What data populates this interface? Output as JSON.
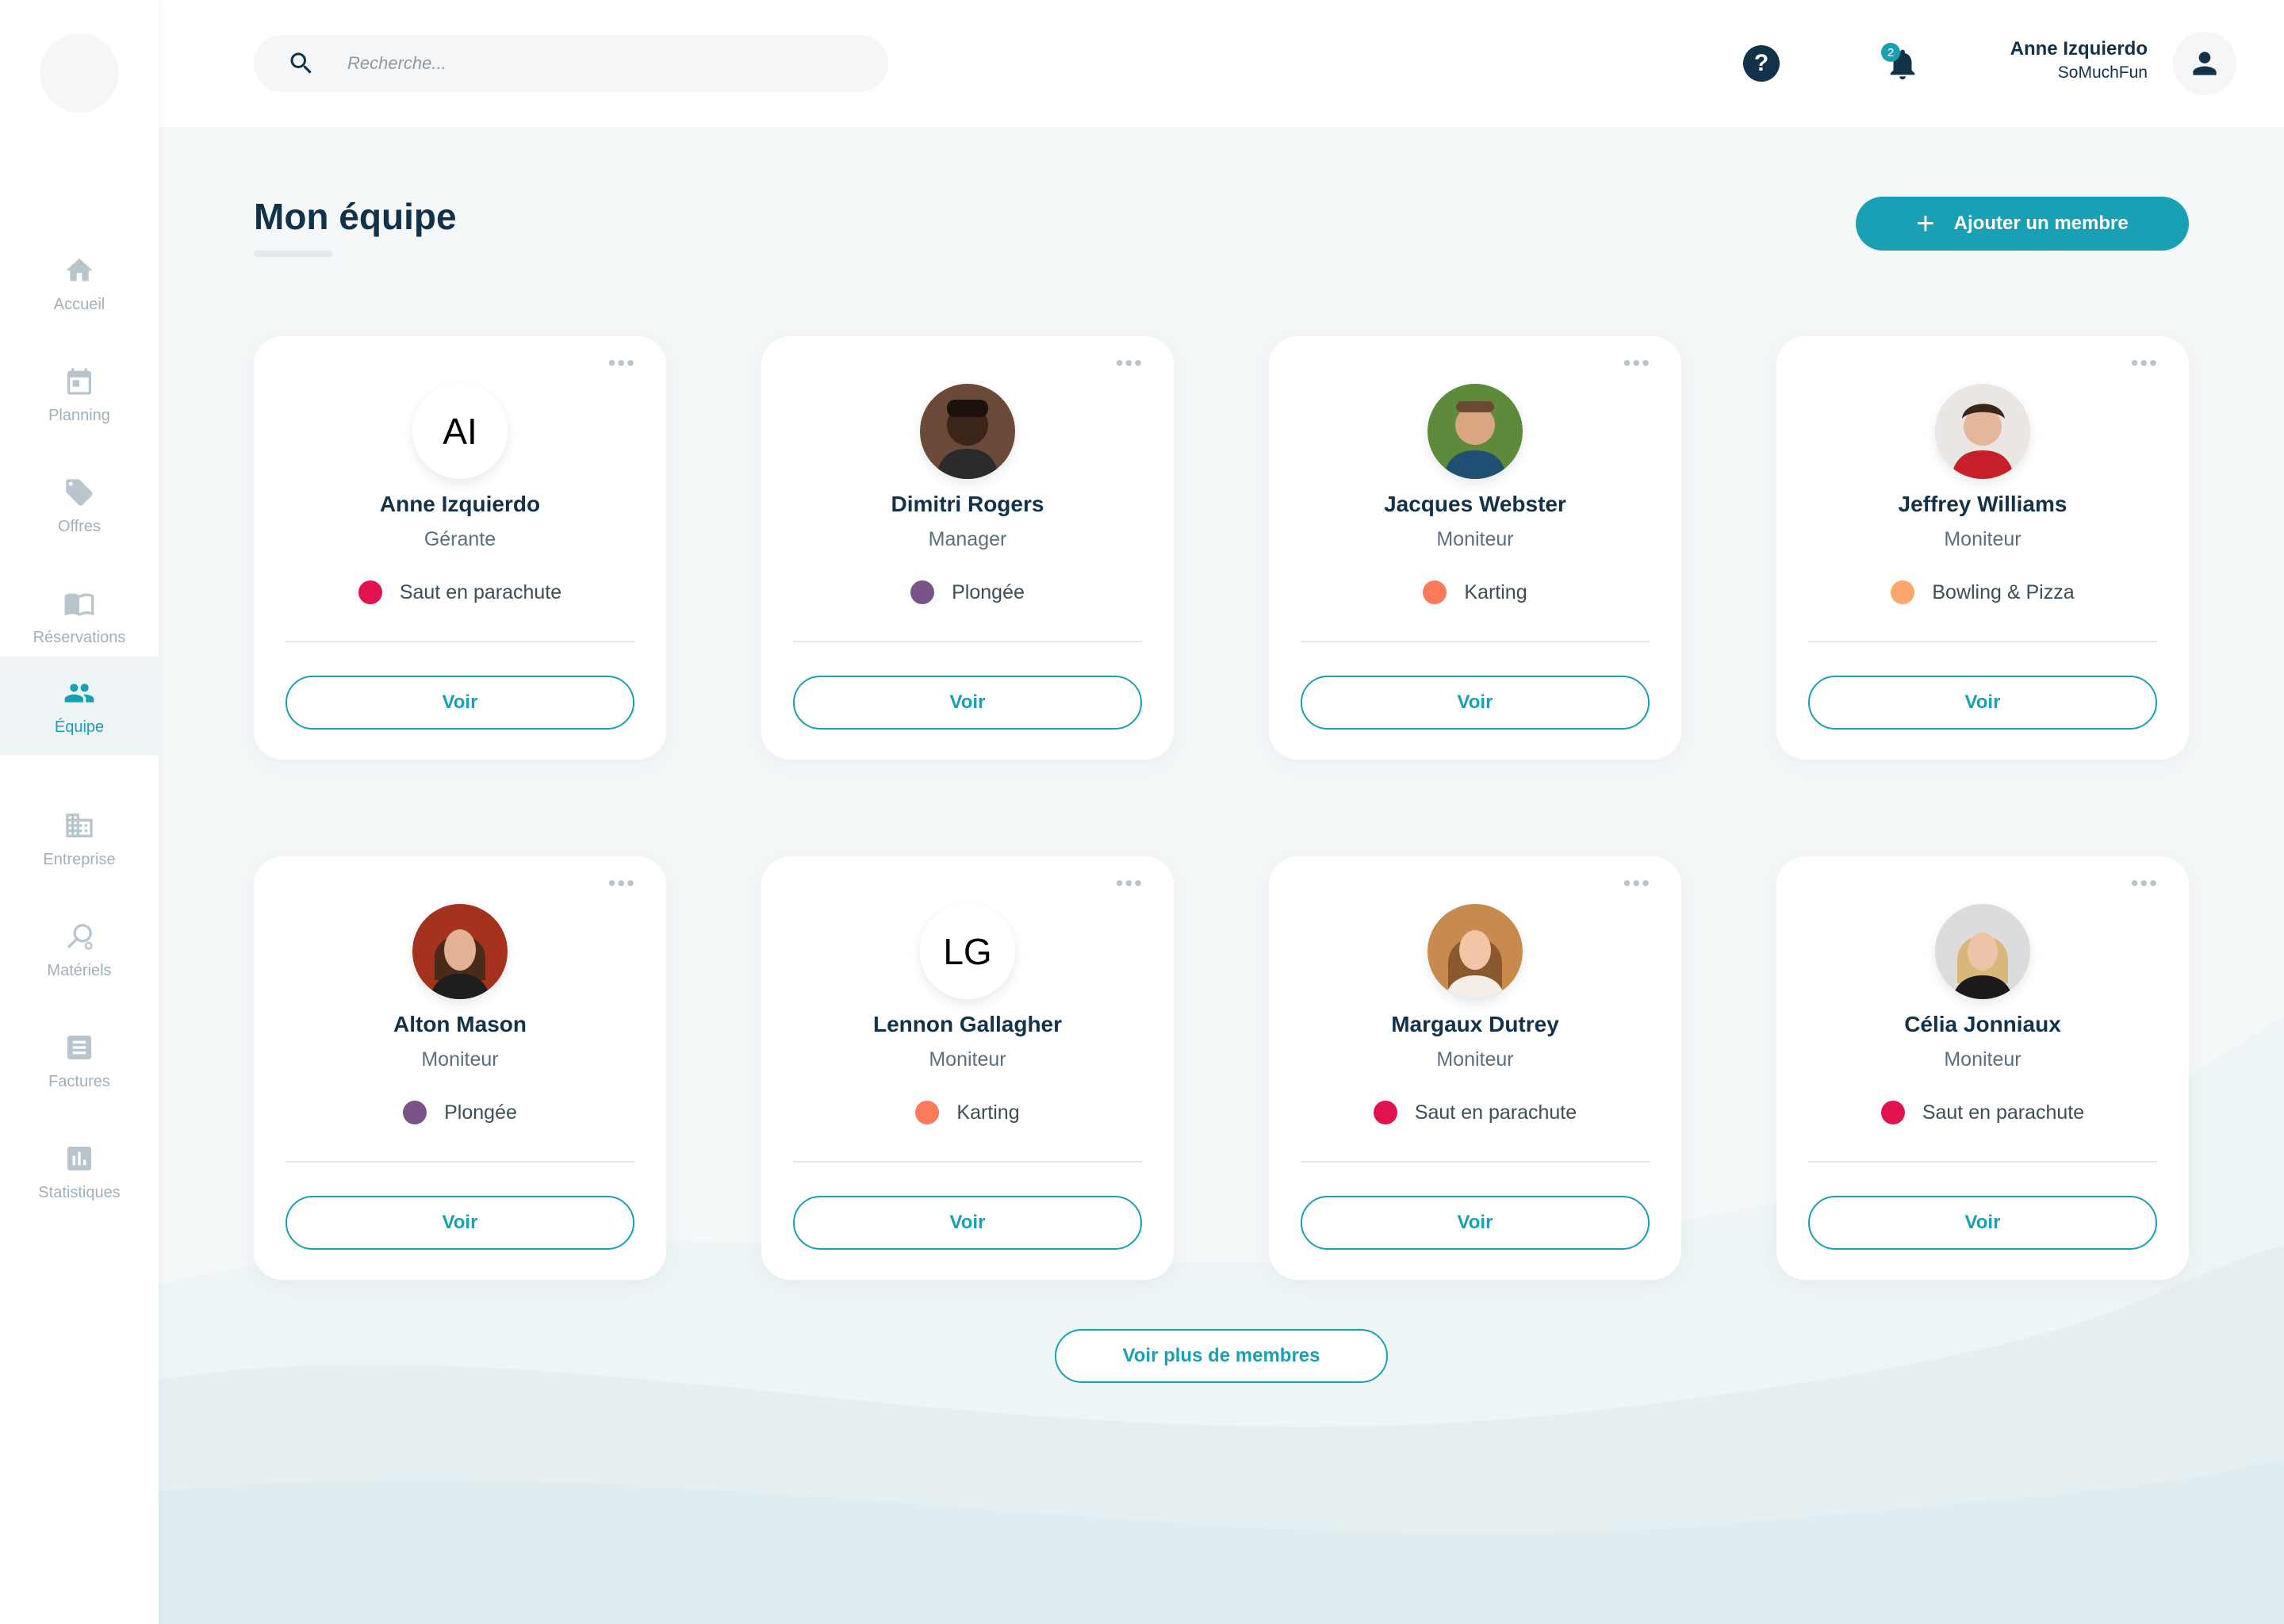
{
  "search": {
    "placeholder": "Recherche..."
  },
  "header": {
    "notifications_count": "2",
    "help_label": "?",
    "user_name": "Anne Izquierdo",
    "user_company": "SoMuchFun"
  },
  "sidebar": {
    "items": [
      {
        "label": "Accueil",
        "icon": "home-icon"
      },
      {
        "label": "Planning",
        "icon": "calendar-icon"
      },
      {
        "label": "Offres",
        "icon": "tag-icon"
      },
      {
        "label": "Réservations",
        "icon": "book-icon"
      },
      {
        "label": "Équipe",
        "icon": "team-icon",
        "active": true
      },
      {
        "label": "Entreprise",
        "icon": "building-icon"
      },
      {
        "label": "Matériels",
        "icon": "racket-icon"
      },
      {
        "label": "Factures",
        "icon": "invoice-icon"
      },
      {
        "label": "Statistiques",
        "icon": "chart-icon"
      }
    ]
  },
  "main": {
    "title": "Mon équipe",
    "add_button_label": "Ajouter un membre",
    "more_members_label": "Voir plus de membres",
    "members": [
      {
        "name": "Anne Izquierdo",
        "role": "Gérante",
        "activity": "Saut en parachute",
        "activity_color": "#e0134f",
        "initials": "AI",
        "photo": false,
        "view_label": "Voir",
        "more_label": "•••"
      },
      {
        "name": "Dimitri Rogers",
        "role": "Manager",
        "activity": "Plongée",
        "activity_color": "#7a5388",
        "initials": "",
        "photo": true,
        "view_label": "Voir",
        "more_label": "•••"
      },
      {
        "name": "Jacques Webster",
        "role": "Moniteur",
        "activity": "Karting",
        "activity_color": "#f97b5a",
        "initials": "",
        "photo": true,
        "view_label": "Voir",
        "more_label": "•••"
      },
      {
        "name": "Jeffrey Williams",
        "role": "Moniteur",
        "activity": "Bowling & Pizza",
        "activity_color": "#fba76d",
        "initials": "",
        "photo": true,
        "view_label": "Voir",
        "more_label": "•••"
      },
      {
        "name": "Alton Mason",
        "role": "Moniteur",
        "activity": "Plongée",
        "activity_color": "#7a5388",
        "initials": "",
        "photo": true,
        "view_label": "Voir",
        "more_label": "•••"
      },
      {
        "name": "Lennon Gallagher",
        "role": "Moniteur",
        "activity": "Karting",
        "activity_color": "#f97b5a",
        "initials": "LG",
        "photo": false,
        "view_label": "Voir",
        "more_label": "•••"
      },
      {
        "name": "Margaux Dutrey",
        "role": "Moniteur",
        "activity": "Saut en parachute",
        "activity_color": "#e0134f",
        "initials": "",
        "photo": true,
        "view_label": "Voir",
        "more_label": "•••"
      },
      {
        "name": "Célia Jonniaux",
        "role": "Moniteur",
        "activity": "Saut en parachute",
        "activity_color": "#e0134f",
        "initials": "",
        "photo": true,
        "view_label": "Voir",
        "more_label": "•••"
      }
    ]
  },
  "colors": {
    "accent": "#1aa0b4",
    "navy": "#12324a",
    "background": "#f5f8f9"
  }
}
